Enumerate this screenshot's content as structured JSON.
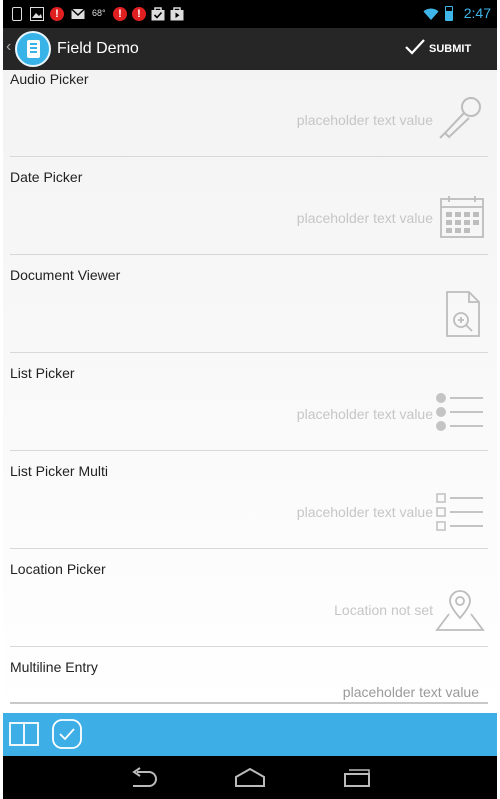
{
  "status_bar": {
    "time": "2:47",
    "temperature": "68°",
    "icons": [
      "notification-icon",
      "image-icon",
      "alert-icon",
      "gmail-icon",
      "alert-icon",
      "alert-icon",
      "bag-check-icon",
      "play-store-icon",
      "wifi-icon",
      "battery-icon"
    ]
  },
  "action_bar": {
    "title": "Field Demo",
    "submit_label": "SUBMIT"
  },
  "fields": [
    {
      "label": "Audio Picker",
      "value": "placeholder text value",
      "icon": "microphone-icon"
    },
    {
      "label": "Date Picker",
      "value": "placeholder text value",
      "icon": "calendar-icon"
    },
    {
      "label": "Document Viewer",
      "value": "",
      "icon": "document-search-icon"
    },
    {
      "label": "List Picker",
      "value": "placeholder text value",
      "icon": "list-icon"
    },
    {
      "label": "List Picker Multi",
      "value": "placeholder text value",
      "icon": "checklist-icon"
    },
    {
      "label": "Location Picker",
      "value": "Location not set",
      "icon": "map-pin-icon"
    },
    {
      "label": "Multiline Entry",
      "value": "placeholder text value",
      "icon": ""
    }
  ],
  "bottom_toolbar": {
    "icons": [
      "book-icon",
      "check-circle-icon"
    ]
  },
  "nav_bar": {
    "icons": [
      "back-icon",
      "home-icon",
      "recents-icon"
    ]
  },
  "colors": {
    "accent": "#3eaee6",
    "action_bar": "#262626",
    "time": "#3fb6ea",
    "alert": "#e02020"
  }
}
